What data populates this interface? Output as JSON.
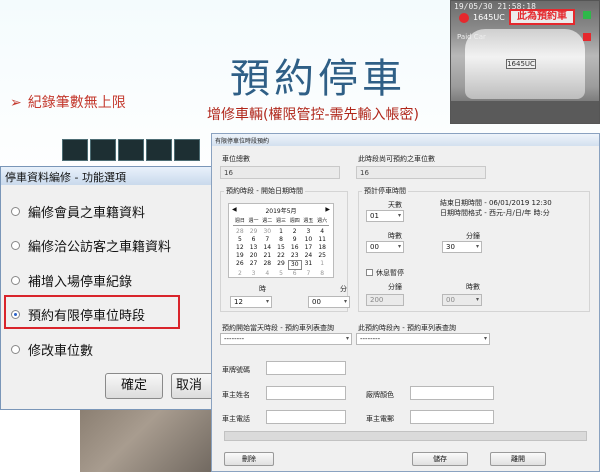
{
  "slide": {
    "title": "預約停車",
    "bullet": "紀錄筆數無上限",
    "subtitle": "增修車輛(權限管控-需先輸入帳密)"
  },
  "camera": {
    "timestamp": "19/05/30  21:58:18",
    "zone_label": "此為預約車",
    "plate_tag": "1645UC",
    "paid_text": "Paid Car",
    "plate": "1645UC"
  },
  "menu_dialog": {
    "title": "停車資料編修 - 功能選項",
    "options": [
      "編修會員之車籍資料",
      "編修洽公訪客之車籍資料",
      "補增入場停車紀錄",
      "預約有限停車位時段",
      "修改車位數"
    ],
    "selected_index": 3,
    "ok_label": "確定",
    "cancel_label": "取消"
  },
  "reserve_dialog": {
    "title": "有限停車位時段預約",
    "total_label": "車位總數",
    "total_value": "16",
    "available_label": "此時段尚可預約之車位數",
    "available_value": "16",
    "start_group_label": "預約時段 - 開始日期時間",
    "calendar": {
      "header": "2019年5月",
      "prev": "◀",
      "next": "▶",
      "weekdays": [
        "週日",
        "週一",
        "週二",
        "週三",
        "週四",
        "週五",
        "週六"
      ],
      "days": [
        "28",
        "29",
        "30",
        "1",
        "2",
        "3",
        "4",
        "5",
        "6",
        "7",
        "8",
        "9",
        "10",
        "11",
        "12",
        "13",
        "14",
        "15",
        "16",
        "17",
        "18",
        "19",
        "20",
        "21",
        "22",
        "23",
        "24",
        "25",
        "26",
        "27",
        "28",
        "29",
        "30",
        "31",
        "1",
        "2",
        "3",
        "4",
        "5",
        "6",
        "7",
        "8"
      ],
      "today": "30"
    },
    "hour_label": "時",
    "minute_label": "分",
    "start_hour": "12",
    "start_minute": "00",
    "duration_group_label": "預計停車時間",
    "days_label": "天數",
    "days_value": "01",
    "end_info_line1": "結束日期時間 - 06/01/2019 12:30",
    "end_info_line2": "日期時間格式 - 西元-月/日/年 時:分",
    "hours_label": "時數",
    "hours_value": "00",
    "mins_label": "分鐘",
    "mins_value": "30",
    "rest_label": "休息暫停",
    "rest_mins_label": "分鐘",
    "rest_mins_value": "200",
    "rest_hours_label": "時數",
    "rest_hours_value": "00",
    "query_start_label": "預約開始當天時段 - 預約車列表查詢",
    "query_start_value": "--------",
    "query_range_label": "此預約時段內 - 預約車列表查詢",
    "query_range_value": "--------",
    "plate_label": "車牌號碼",
    "owner_label": "車主姓名",
    "color_label": "廠牌顏色",
    "phone_label": "車主電話",
    "email_label": "車主電郵",
    "delete_label": "刪除",
    "save_label": "儲存",
    "exit_label": "離開"
  }
}
